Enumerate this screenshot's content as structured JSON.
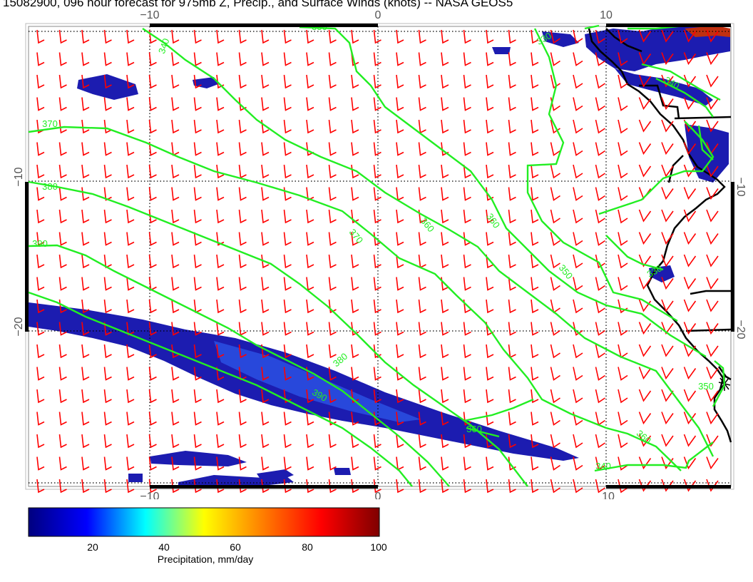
{
  "title": "15082900, 096 hour forecast for 975mb Z, Precip., and Surface Winds (knots) -- NASA GEOS5",
  "axes": {
    "top_ticks": [
      "−10",
      "0",
      "10"
    ],
    "bottom_ticks": [
      "−10",
      "0",
      "10"
    ],
    "left_ticks": [
      "−10",
      "−20"
    ],
    "right_ticks": [
      "−10",
      "−20"
    ]
  },
  "contours": {
    "color": "#22ee22",
    "labels": [
      "340",
      "350",
      "370",
      "380",
      "390",
      "360",
      "370",
      "360",
      "350",
      "330",
      "340",
      "380",
      "390",
      "360",
      "330",
      "350",
      "360",
      "340"
    ]
  },
  "wind_barbs": {
    "color": "#ff0000"
  },
  "coastline": {
    "color": "#000000"
  },
  "precip": {
    "fill": "#1c1cb0",
    "core": "#2a4ee0"
  },
  "colorbar": {
    "label": "Precipitation, mm/day",
    "ticks": [
      "20",
      "40",
      "60",
      "80",
      "100"
    ],
    "stops": [
      "#00007f",
      "#0000ff",
      "#00ffff",
      "#ffff00",
      "#ff7f00",
      "#ff0000",
      "#7f0000"
    ]
  }
}
